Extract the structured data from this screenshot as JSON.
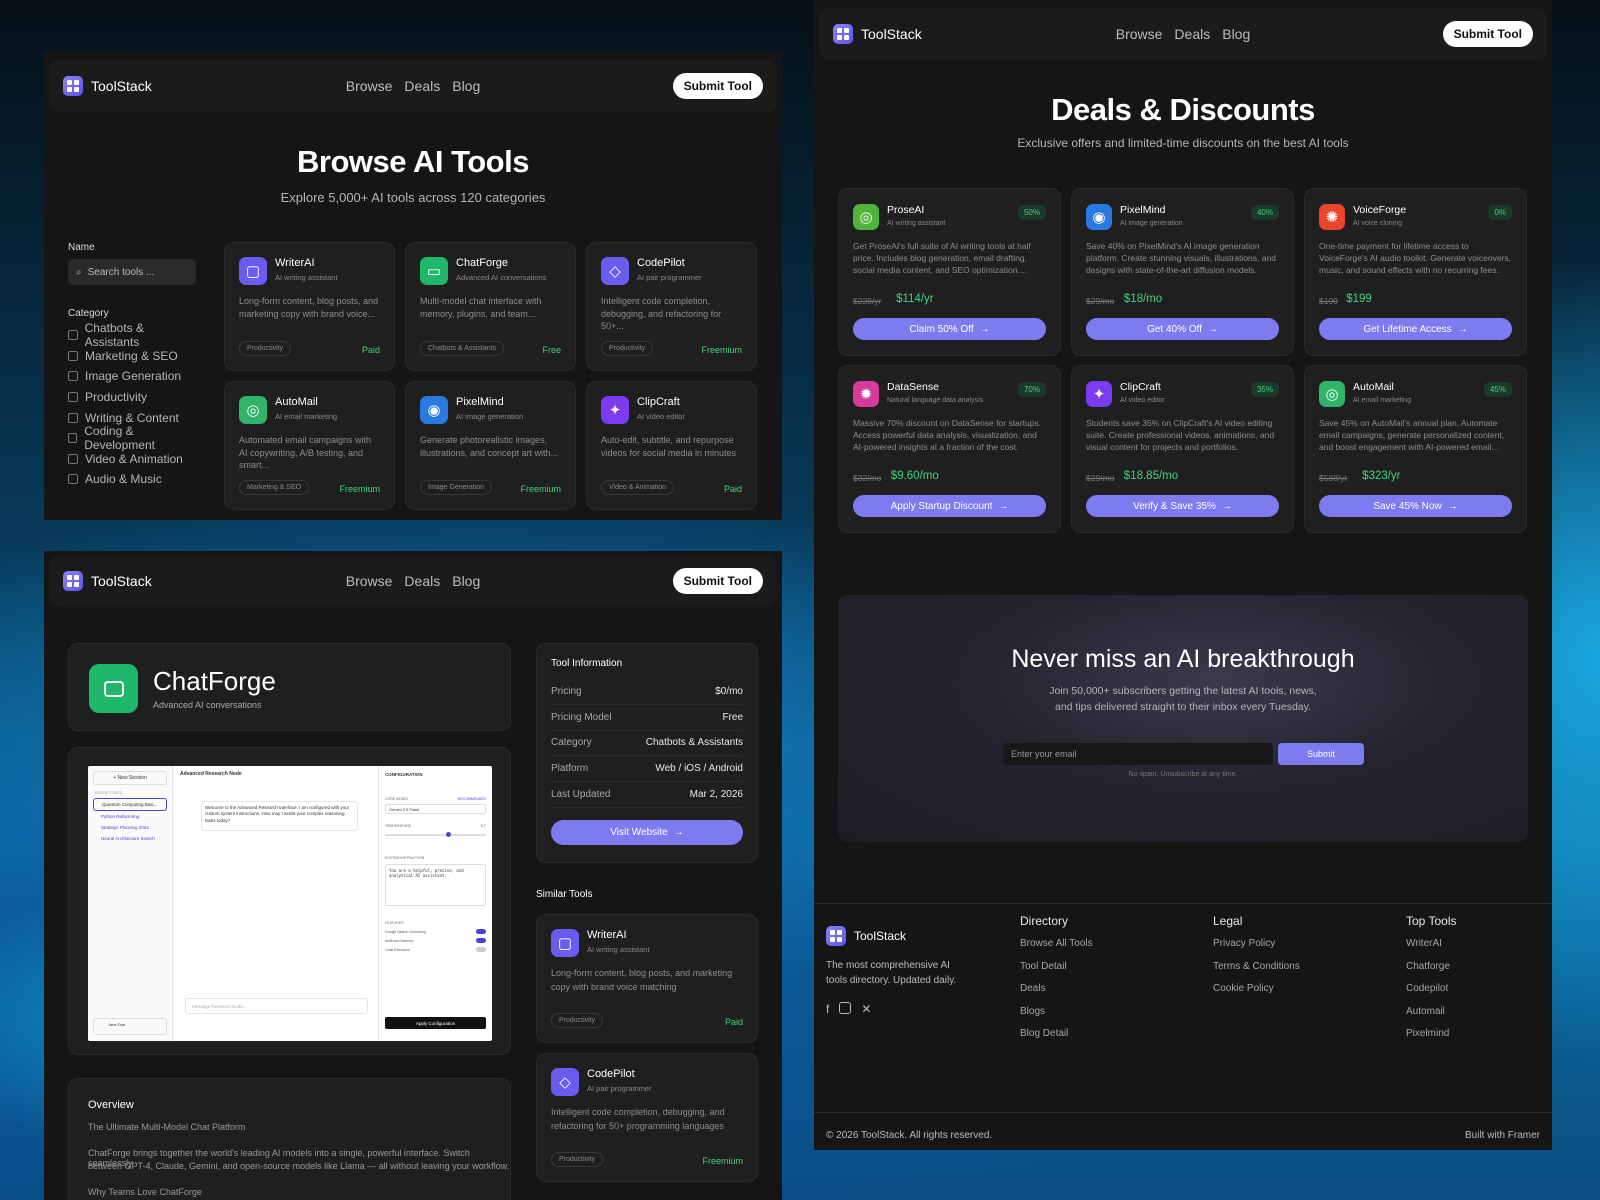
{
  "brand": {
    "name": "ToolStack",
    "accent": "#7d7bf0"
  },
  "nav": {
    "links": [
      "Browse",
      "Deals",
      "Blog"
    ],
    "cta": "Submit Tool"
  },
  "browse": {
    "title": "Browse AI Tools",
    "subtitle": "Explore 5,000+ AI tools across 120 categories",
    "filters": {
      "name_label": "Name",
      "search_placeholder": "Search tools ...",
      "category_label": "Category",
      "categories": [
        "Chatbots & Assistants",
        "Marketing & SEO",
        "Image Generation",
        "Productivity",
        "Writing & Content",
        "Coding & Development",
        "Video & Animation",
        "Audio & Music"
      ]
    },
    "tools": [
      {
        "name": "WriterAI",
        "sub": "AI writing assistant",
        "desc": "Long-form content, blog posts, and marketing copy with brand voice...",
        "tag": "Productivity",
        "price": "Paid",
        "color": "#6a5cf0",
        "icon": "square-icon"
      },
      {
        "name": "ChatForge",
        "sub": "Advanced AI conversations",
        "desc": "Multi-model chat interface with memory, plugins, and team...",
        "tag": "Chatbots & Assistants",
        "price": "Free",
        "color": "#1fb86a",
        "icon": "chat-icon"
      },
      {
        "name": "CodePilot",
        "sub": "AI pair programmer",
        "desc": "Intelligent code completion, debugging, and refactoring for 50+...",
        "tag": "Productivity",
        "price": "Freemium",
        "color": "#6a5cf0",
        "icon": "layers-icon"
      },
      {
        "name": "AutoMail",
        "sub": "AI email marketing",
        "desc": "Automated email campaigns with AI copywriting, A/B testing, and smart...",
        "tag": "Marketing & SEO",
        "price": "Freemium",
        "color": "#2fb46a",
        "icon": "spiral-icon"
      },
      {
        "name": "PixelMind",
        "sub": "AI image generation",
        "desc": "Generate photorealistic images, illustrations, and concept art with...",
        "tag": "Image Generation",
        "price": "Freemium",
        "color": "#2a79e0",
        "icon": "eye-icon"
      },
      {
        "name": "ClipCraft",
        "sub": "AI video editor",
        "desc": "Auto-edit, subtitle, and repurpose videos for social media in minutes",
        "tag": "Video & Animation",
        "price": "Paid",
        "color": "#7b3cf0",
        "icon": "sparkle-icon"
      }
    ]
  },
  "deals": {
    "title": "Deals & Discounts",
    "subtitle": "Exclusive offers and limited-time discounts on the best AI tools",
    "items": [
      {
        "name": "ProseAI",
        "sub": "AI writing assistant",
        "badge": "50%",
        "desc": "Get ProseAI's full suite of AI writing tools at half price. Includes blog generation, email drafting, social media content, and SEO optimization....",
        "old": "$228/yr",
        "new": "$114/yr",
        "cta": "Claim 50% Off",
        "color": "#4fb53a",
        "icon": "ring-icon"
      },
      {
        "name": "PixelMind",
        "sub": "AI image generation",
        "badge": "40%",
        "desc": "Save 40% on PixelMind's AI image generation platform. Create stunning visuals, illustrations, and designs with state-of-the-art diffusion models.",
        "old": "$29/mo",
        "new": "$18/mo",
        "cta": "Get 40% Off",
        "color": "#2a79e0",
        "icon": "eye-icon"
      },
      {
        "name": "VoiceForge",
        "sub": "AI voice cloning",
        "badge": "0%",
        "desc": "One-time payment for lifetime access to VoiceForge's AI audio toolkit. Generate voiceovers, music, and sound effects with no recurring fees.",
        "old": "$199",
        "new": "$199",
        "cta": "Get Lifetime Access",
        "color": "#e8452c",
        "icon": "sun-icon"
      },
      {
        "name": "DataSense",
        "sub": "Natural language data analysis",
        "badge": "70%",
        "desc": "Massive 70% discount on DataSense for startups. Access powerful data analysis, visualization, and AI-powered insights at a fraction of the cost.",
        "old": "$32/mo",
        "new": "$9.60/mo",
        "cta": "Apply Startup Discount",
        "color": "#d63a9a",
        "icon": "burst-icon"
      },
      {
        "name": "ClipCraft",
        "sub": "AI video editor",
        "badge": "35%",
        "desc": "Students save 35% on ClipCraft's AI video editing suite. Create professional videos, animations, and visual content for projects and portfolios.",
        "old": "$29/mo",
        "new": "$18.85/mo",
        "cta": "Verify & Save 35%",
        "color": "#7b3cf0",
        "icon": "sparkle-icon"
      },
      {
        "name": "AutoMail",
        "sub": "AI email marketing",
        "badge": "45%",
        "desc": "Save 45% on AutoMail's annual plan. Automate email campaigns, generate personalized content, and boost engagement with AI-powered email...",
        "old": "$588/yr",
        "new": "$323/yr",
        "cta": "Save 45% Now",
        "color": "#2fb46a",
        "icon": "spiral-icon"
      }
    ]
  },
  "newsletter": {
    "title": "Never miss an AI breakthrough",
    "text1": "Join 50,000+ subscribers getting the latest AI tools, news,",
    "text2": "and tips delivered straight to their inbox every Tuesday.",
    "placeholder": "Enter your email",
    "cta": "Submit",
    "note": "No spam. Unsubscribe at any time."
  },
  "footer": {
    "tagline1": "The most comprehensive AI",
    "tagline2": "tools directory. Updated daily.",
    "social": [
      "facebook-icon",
      "instagram-icon",
      "x-icon"
    ],
    "cols": [
      {
        "title": "Directory",
        "links": [
          "Browse All Tools",
          "Tool Detail",
          "Deals",
          "Blogs",
          "Blog Detail"
        ]
      },
      {
        "title": "Legal",
        "links": [
          "Privacy Policy",
          "Terms & Conditions",
          "Cookie Policy"
        ]
      },
      {
        "title": "Top Tools",
        "links": [
          "WriterAI",
          "Chatforge",
          "Codepilot",
          "Automail",
          "Pixelmind"
        ]
      }
    ],
    "copyright": "© 2026 ToolStack. All rights reserved.",
    "built": "Built with Framer"
  },
  "detail": {
    "name": "ChatForge",
    "sub": "Advanced AI conversations",
    "info_title": "Tool Information",
    "info": [
      [
        "Pricing",
        "$0/mo"
      ],
      [
        "Pricing Model",
        "Free"
      ],
      [
        "Category",
        "Chatbots & Assistants"
      ],
      [
        "Platform",
        "Web / iOS / Android"
      ],
      [
        "Last Updated",
        "Mar 2, 2026"
      ]
    ],
    "visit": "Visit Website",
    "similar_title": "Similar Tools",
    "similar": [
      {
        "name": "WriterAI",
        "sub": "AI writing assistant",
        "desc1": "Long-form content, blog posts, and marketing",
        "desc2": "copy with brand voice matching",
        "tag": "Productivity",
        "price": "Paid"
      },
      {
        "name": "CodePilot",
        "sub": "AI pair programmer",
        "desc1": "Intelligent code completion, debugging, and",
        "desc2": "refactoring for 50+ programming languages",
        "tag": "Productivity",
        "price": "Freemium"
      }
    ],
    "overview_title": "Overview",
    "overview_sub": "The Ultimate Multi-Model Chat Platform",
    "overview_p1": "ChatForge brings together the world's leading AI models into a single, powerful interface. Switch seamlessly",
    "overview_p2": "between GPT-4, Claude, Gemini, and open-source models like Llama — all without leaving your workflow.",
    "overview_h": "Why Teams Love ChatForge",
    "shot": {
      "new_session": "+ New Session",
      "recent": "RECENT CHATS",
      "chats": [
        "Quantum Computing Basi...",
        "Python Refactoring",
        "Strategic Planning 2024",
        "Neural Architecture Search"
      ],
      "header": "Advanced Research Node",
      "message": "Welcome to the Advanced Research Interface. I am configured with your custom system instructions. How may I assist your complex reasoning tasks today?",
      "config": "CONFIGURATION",
      "model_label": "CORE MODEL",
      "recommended": "RECOMMENDED",
      "model": "Gemini 2.5 Flash",
      "temp_label": "TEMPERATURE",
      "temp": "0.7",
      "sys_label": "SYSTEM INSTRUCTION",
      "sys": "You are a helpful, precise, and analytical AI assistant.",
      "features": "FEATURES",
      "f": [
        "Google Search Grounding",
        "Multi-turn Memory",
        "Code Execution"
      ],
      "input": "Message Research Node...",
      "apply": "Apply Configuration",
      "user": "Jane Doe"
    }
  }
}
